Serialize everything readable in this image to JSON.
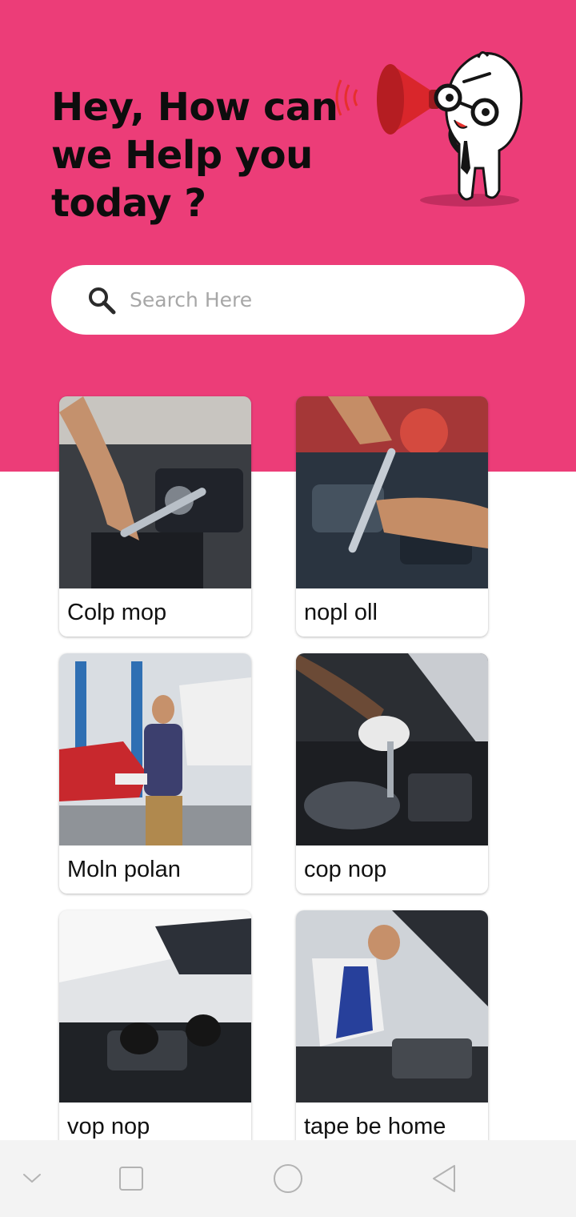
{
  "header": {
    "headline_lines": [
      "Hey, How can",
      "we Help you",
      "today ?"
    ],
    "accent_color": "#ec3d78",
    "illustration": "mascot-megaphone-illustration"
  },
  "search": {
    "placeholder": "Search Here",
    "icon": "search-icon"
  },
  "services": [
    {
      "label": "Colp mop",
      "photo": "mechanic-wrench-engine-photo"
    },
    {
      "label": "nopl oll",
      "photo": "socket-wrench-engine-photo"
    },
    {
      "label": "Moln polan",
      "photo": "workshop-manager-photo"
    },
    {
      "label": "cop nop",
      "photo": "gloved-hands-engine-photo"
    },
    {
      "label": "vop nop",
      "photo": "mechanic-under-hood-photo"
    },
    {
      "label": "tape be home",
      "photo": "mechanic-inspecting-engine-photo"
    }
  ],
  "navbar": {
    "buttons": [
      "chevron-down-icon",
      "recents-square-icon",
      "home-circle-icon",
      "back-triangle-icon"
    ]
  }
}
